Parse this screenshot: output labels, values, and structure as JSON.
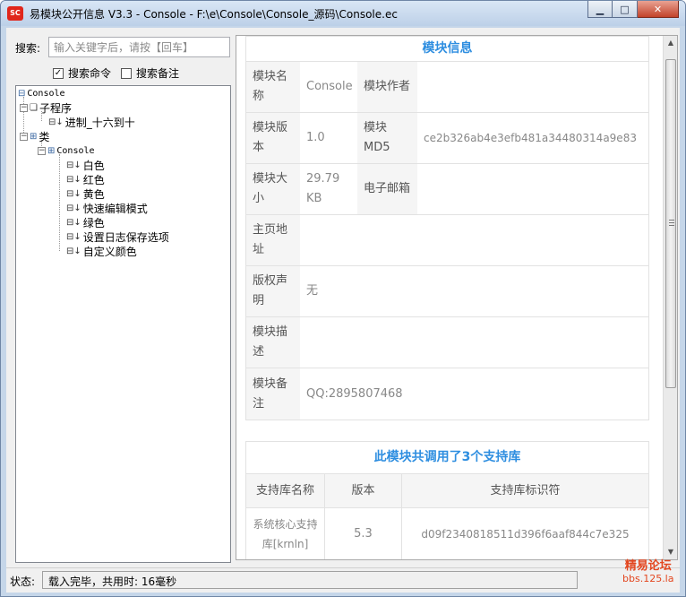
{
  "window": {
    "app_icon": "SC",
    "title": "易模块公开信息 V3.3 - Console - F:\\e\\Console\\Console_源码\\Console.ec"
  },
  "search": {
    "label": "搜索:",
    "placeholder": "输入关键字后，请按【回车】",
    "value": "",
    "opt_command": "搜索命令",
    "opt_command_checked": true,
    "opt_note": "搜索备注",
    "opt_note_checked": false
  },
  "tree": {
    "root": "Console",
    "subs_group": "子程序",
    "sub_item": "进制_十六到十",
    "classes_group": "类",
    "class_name": "Console",
    "methods": [
      "白色",
      "红色",
      "黄色",
      "快速编辑模式",
      "绿色",
      "设置日志保存选项",
      "自定义颜色"
    ]
  },
  "module_info": {
    "heading": "模块信息",
    "name_label": "模块名称",
    "name_value": "Console",
    "author_label": "模块作者",
    "author_value": "",
    "version_label": "模块版本",
    "version_value": "1.0",
    "md5_label": "模块MD5",
    "md5_value": "ce2b326ab4e3efb481a34480314a9e83",
    "size_label": "模块大小",
    "size_value": "29.79 KB",
    "email_label": "电子邮箱",
    "email_value": "",
    "homepage_label": "主页地址",
    "homepage_value": "",
    "copyright_label": "版权声明",
    "copyright_value": "无",
    "desc_label": "模块描述",
    "desc_value": "",
    "note_label": "模块备注",
    "note_value": "QQ:2895807468"
  },
  "libs": {
    "heading": "此模块共调用了3个支持库",
    "col_name": "支持库名称",
    "col_version": "版本",
    "col_id": "支持库标识符",
    "rows": [
      {
        "name": "系统核心支持库[krnln]",
        "version": "5.3",
        "id": "d09f2340818511d396f6aaf844c7e325"
      }
    ]
  },
  "status": {
    "label": "状态:",
    "text": "载入完毕，共用时: 16毫秒"
  },
  "watermark": {
    "line1": "精易论坛",
    "line2": "bbs.125.la"
  }
}
